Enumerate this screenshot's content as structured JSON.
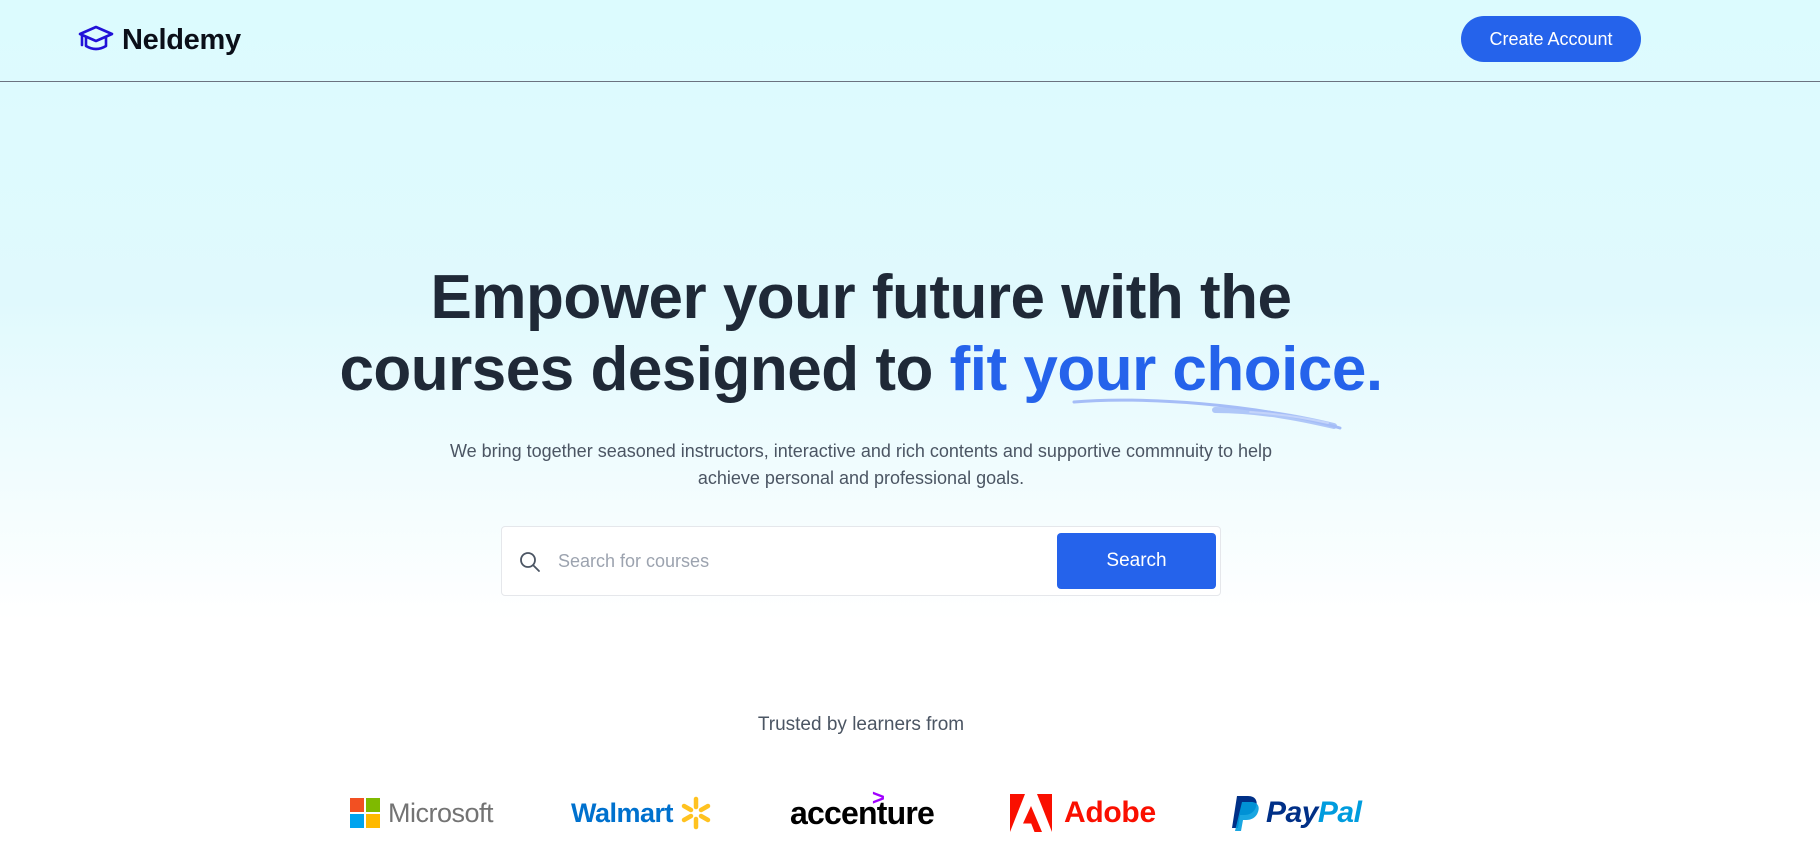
{
  "header": {
    "brand_name": "Neldemy",
    "create_account_label": "Create Account"
  },
  "hero": {
    "title_line1": "Empower your future with the",
    "title_line2_plain": "courses designed to ",
    "title_line2_accent": "fit your choice.",
    "subtitle": "We bring together seasoned instructors, interactive and rich contents and supportive commnuity to help achieve personal and professional goals."
  },
  "search": {
    "placeholder": "Search for courses",
    "button_label": "Search"
  },
  "trusted": {
    "label": "Trusted by learners from",
    "logos": [
      {
        "name": "Microsoft"
      },
      {
        "name": "Walmart"
      },
      {
        "name": "accenture"
      },
      {
        "name": "Adobe"
      },
      {
        "name_pay": "Pay",
        "name_pal": "Pal"
      }
    ]
  },
  "colors": {
    "accent": "#2563eb",
    "heading": "#1f2937",
    "muted": "#4b5563"
  },
  "icons": {
    "brand": "graduation-cap-icon",
    "search": "search-icon"
  }
}
